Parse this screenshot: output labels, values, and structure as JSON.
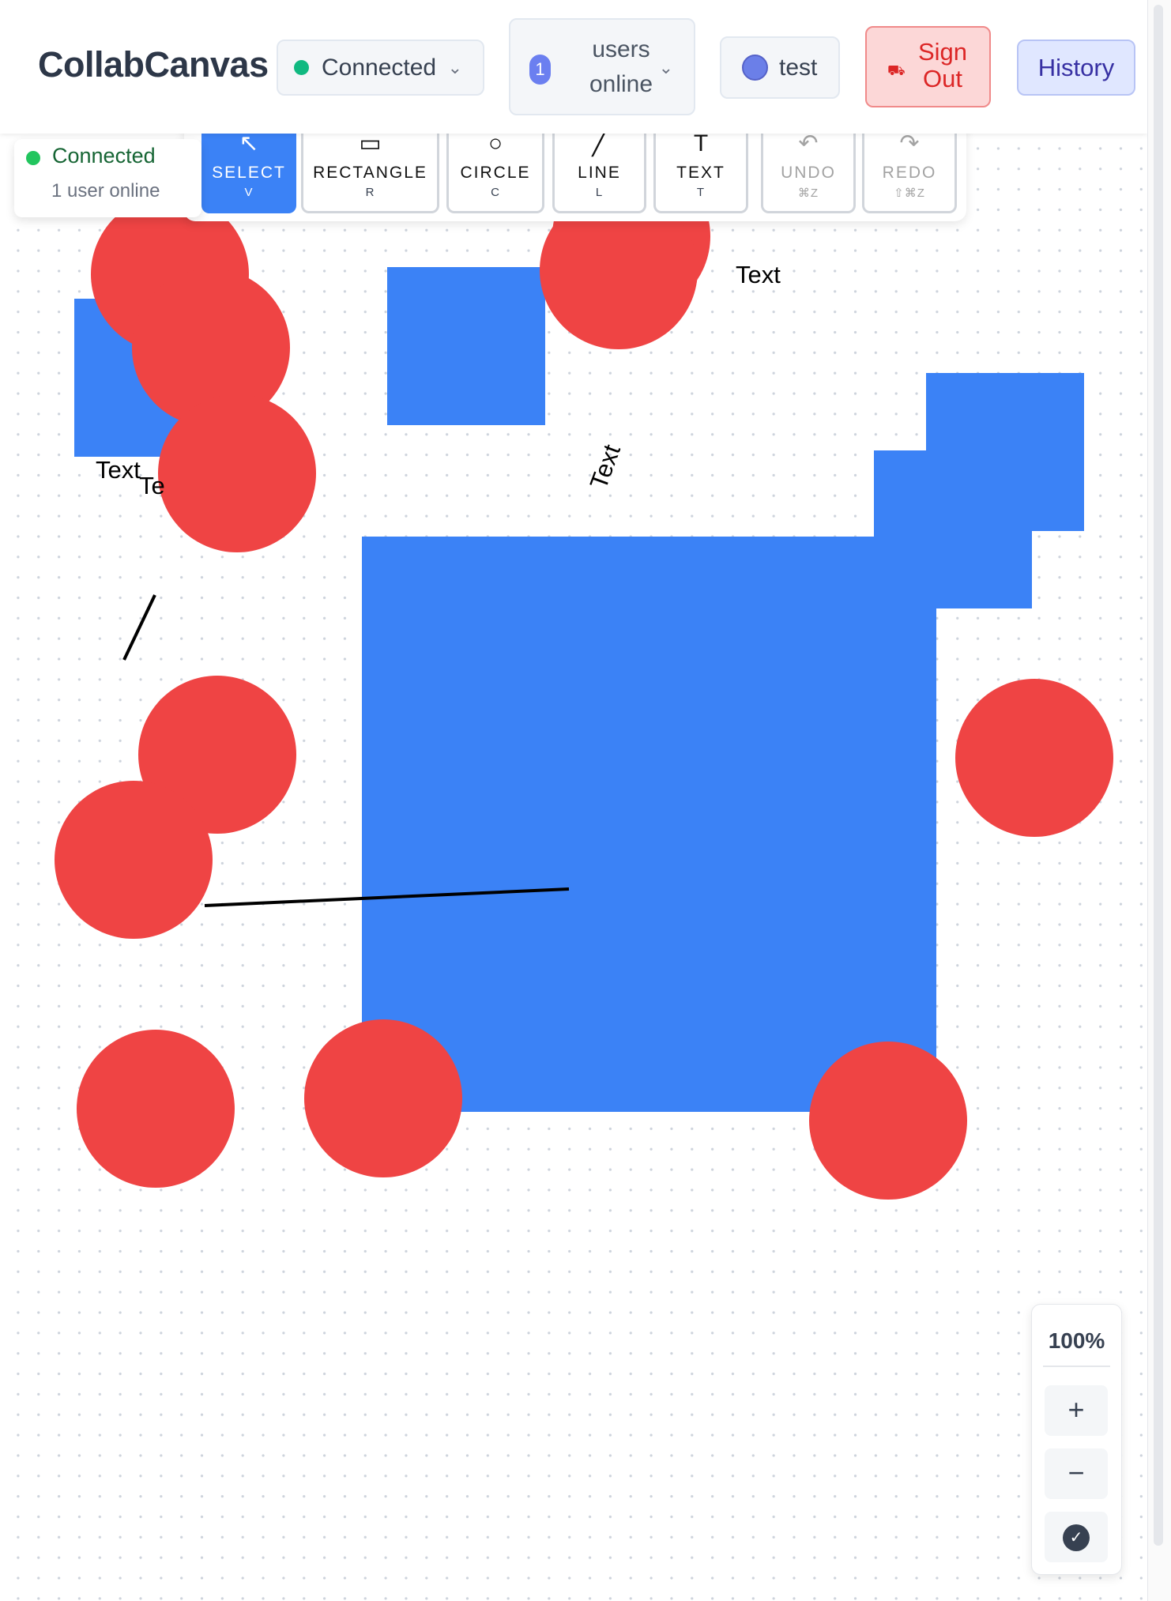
{
  "header": {
    "app_title": "CollabCanvas",
    "connection_status": "Connected",
    "users_online_count": "1",
    "users_online_label": "users online",
    "current_user": "test",
    "sign_out_label": "Sign Out",
    "history_label": "History"
  },
  "presence": {
    "status": "Connected",
    "users_online": "1 user online"
  },
  "toolbar": {
    "tools": [
      {
        "label": "SELECT",
        "shortcut": "V",
        "icon": "cursor-arrow-icon",
        "glyph": "↖",
        "active": true
      },
      {
        "label": "RECTANGLE",
        "shortcut": "R",
        "icon": "rectangle-icon",
        "glyph": "▭",
        "active": false
      },
      {
        "label": "CIRCLE",
        "shortcut": "C",
        "icon": "circle-icon",
        "glyph": "○",
        "active": false
      },
      {
        "label": "LINE",
        "shortcut": "L",
        "icon": "line-icon",
        "glyph": "╱",
        "active": false
      },
      {
        "label": "TEXT",
        "shortcut": "T",
        "icon": "text-icon",
        "glyph": "T",
        "active": false
      },
      {
        "label": "UNDO",
        "shortcut": "⌘Z",
        "icon": "undo-icon",
        "glyph": "↶",
        "disabled": true
      },
      {
        "label": "REDO",
        "shortcut": "⇧⌘Z",
        "icon": "redo-icon",
        "glyph": "↷",
        "disabled": true
      }
    ]
  },
  "canvas": {
    "text_items": [
      "Text",
      "Text",
      "Te",
      "Text"
    ],
    "shape_colors": {
      "rectangle": "#3b82f6",
      "circle": "#ef4444",
      "line": "#000000"
    }
  },
  "zoom": {
    "level": "100%",
    "zoom_in": "+",
    "zoom_out": "−",
    "fit_icon": "✓"
  },
  "colors": {
    "accent": "#3b82f6",
    "connected": "#10b981",
    "danger": "#dc2626",
    "history": "#3730a3"
  }
}
